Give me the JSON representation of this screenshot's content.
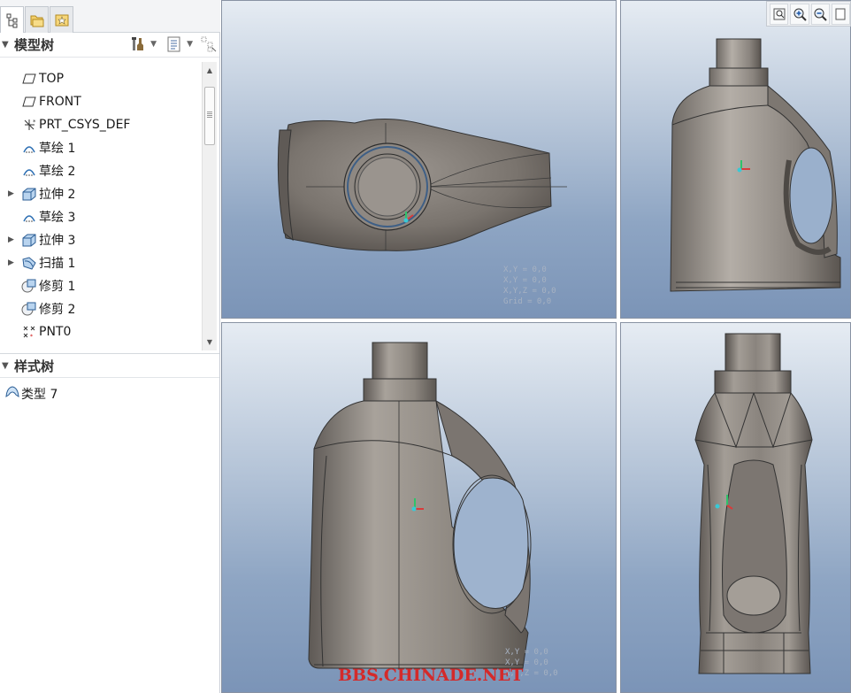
{
  "model_tree": {
    "title": "模型树",
    "items": [
      {
        "label": "TOP",
        "icon": "datum-plane-icon",
        "expandable": false
      },
      {
        "label": "FRONT",
        "icon": "datum-plane-icon",
        "expandable": false
      },
      {
        "label": "PRT_CSYS_DEF",
        "icon": "coordinate-system-icon",
        "expandable": false
      },
      {
        "label": "草绘 1",
        "icon": "sketch-icon",
        "expandable": false
      },
      {
        "label": "草绘 2",
        "icon": "sketch-icon",
        "expandable": false
      },
      {
        "label": "拉伸 2",
        "icon": "extrude-icon",
        "expandable": true
      },
      {
        "label": "草绘 3",
        "icon": "sketch-icon",
        "expandable": false
      },
      {
        "label": "拉伸 3",
        "icon": "extrude-icon",
        "expandable": true
      },
      {
        "label": "扫描 1",
        "icon": "sweep-icon",
        "expandable": true
      },
      {
        "label": "修剪 1",
        "icon": "trim-icon",
        "expandable": false
      },
      {
        "label": "修剪 2",
        "icon": "trim-icon",
        "expandable": false
      },
      {
        "label": "PNT0",
        "icon": "datum-point-icon",
        "expandable": false
      }
    ]
  },
  "style_tree": {
    "title": "样式树",
    "items": [
      {
        "label": "类型 7",
        "icon": "style-type-icon"
      }
    ]
  },
  "viewports": {
    "coords_lines": [
      "X,Y = 0,0",
      "X,Y = 0,0",
      "X,Y,Z = 0,0",
      "Grid = 0,0"
    ]
  },
  "watermark": "BBS.CHINADE.NET",
  "colors": {
    "viewport_top": "#e6ecf3",
    "viewport_bottom": "#7b94b7",
    "model_gray": "#7d7771",
    "watermark": "#d42a2a"
  }
}
